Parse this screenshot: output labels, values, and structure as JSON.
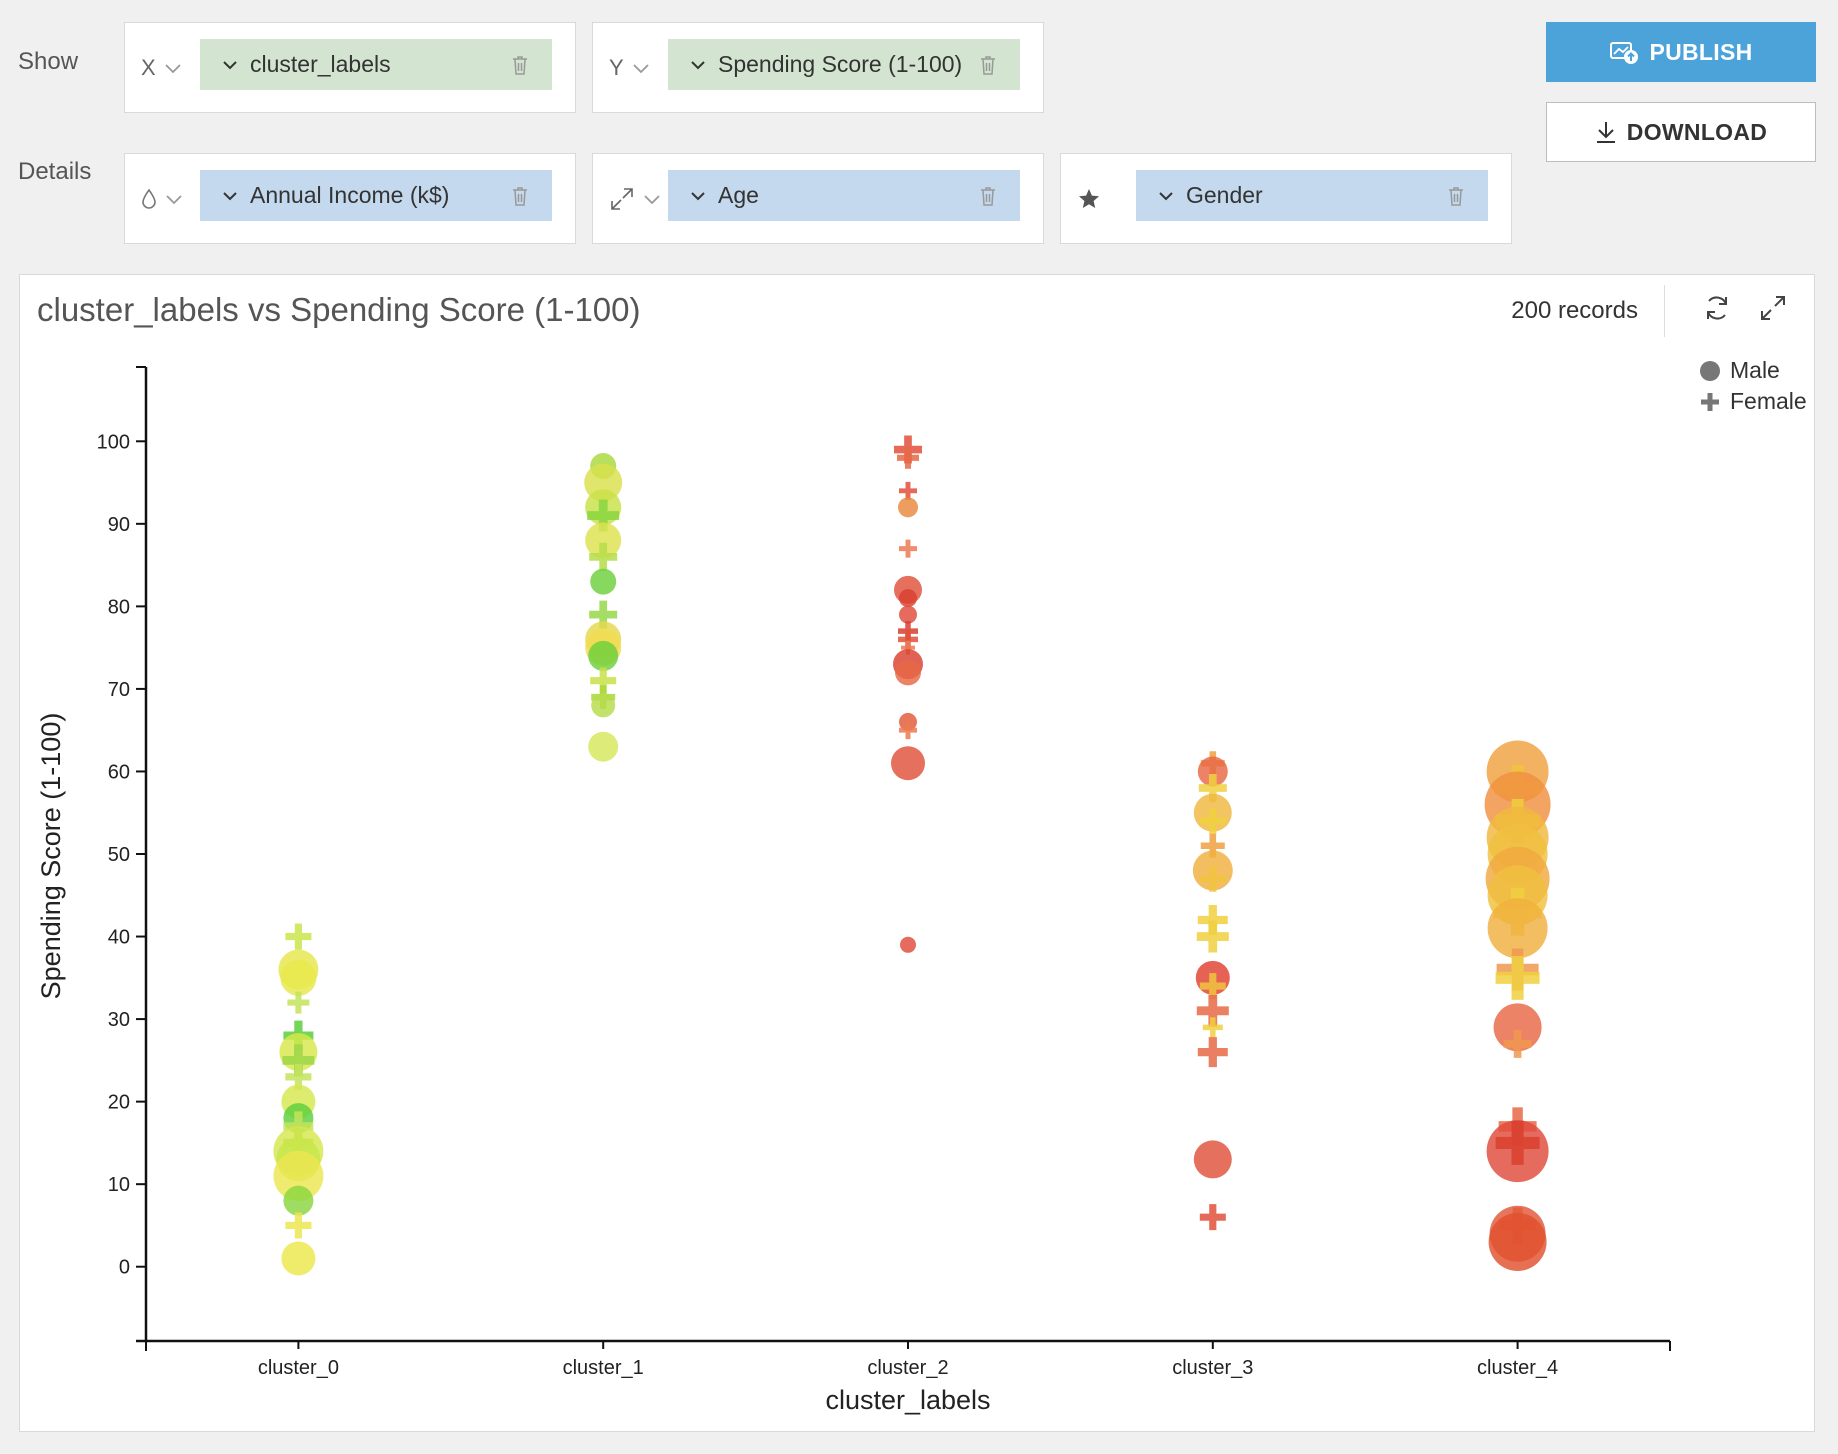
{
  "show_label": "Show",
  "details_label": "Details",
  "x_shelf": {
    "key": "X",
    "field": "cluster_labels"
  },
  "y_shelf": {
    "key": "Y",
    "field": "Spending Score (1-100)"
  },
  "color_shelf": {
    "icon": "droplet-icon",
    "field": "Annual Income (k$)"
  },
  "size_shelf": {
    "icon": "resize-icon",
    "field": "Age"
  },
  "shape_shelf": {
    "icon": "star-icon",
    "field": "Gender"
  },
  "buttons": {
    "publish": "PUBLISH",
    "download": "DOWNLOAD"
  },
  "colors": {
    "accent": "#4ba3da",
    "show_pill": "#d3e5d0",
    "details_pill": "#c4d9ee"
  },
  "panel": {
    "records": "200 records"
  },
  "chart_data": {
    "type": "scatter",
    "title": "cluster_labels vs Spending Score (1-100)",
    "xlabel": "cluster_labels",
    "ylabel": "Spending Score (1-100)",
    "categories": [
      "cluster_0",
      "cluster_1",
      "cluster_2",
      "cluster_3",
      "cluster_4"
    ],
    "ylim": [
      -9,
      109
    ],
    "yticks": [
      0,
      10,
      20,
      30,
      40,
      50,
      60,
      70,
      80,
      90,
      100
    ],
    "grid": false,
    "legend_position": "top-right",
    "legend": [
      {
        "label": "Male",
        "shape": "circle"
      },
      {
        "label": "Female",
        "shape": "plus"
      }
    ],
    "points": [
      {
        "cluster": "cluster_0",
        "y": 40,
        "shape": "plus",
        "size": 13,
        "color": "#c8e64a"
      },
      {
        "cluster": "cluster_0",
        "y": 36,
        "shape": "circle",
        "size": 20,
        "color": "#e6e64a"
      },
      {
        "cluster": "cluster_0",
        "y": 35,
        "shape": "circle",
        "size": 18,
        "color": "#e8e84c"
      },
      {
        "cluster": "cluster_0",
        "y": 32,
        "shape": "plus",
        "size": 11,
        "color": "#c4e35a"
      },
      {
        "cluster": "cluster_0",
        "y": 28,
        "shape": "plus",
        "size": 15,
        "color": "#5ccf3c"
      },
      {
        "cluster": "cluster_0",
        "y": 26,
        "shape": "circle",
        "size": 19,
        "color": "#d8e64a"
      },
      {
        "cluster": "cluster_0",
        "y": 25,
        "shape": "plus",
        "size": 16,
        "color": "#9ed648"
      },
      {
        "cluster": "cluster_0",
        "y": 23,
        "shape": "plus",
        "size": 13,
        "color": "#c4e35a"
      },
      {
        "cluster": "cluster_0",
        "y": 20,
        "shape": "circle",
        "size": 17,
        "color": "#d6e64e"
      },
      {
        "cluster": "cluster_0",
        "y": 18,
        "shape": "circle",
        "size": 15,
        "color": "#5ccf3c"
      },
      {
        "cluster": "cluster_0",
        "y": 17,
        "shape": "plus",
        "size": 15,
        "color": "#c4e35a"
      },
      {
        "cluster": "cluster_0",
        "y": 15,
        "shape": "plus",
        "size": 15,
        "color": "#9ed648"
      },
      {
        "cluster": "cluster_0",
        "y": 14,
        "shape": "circle",
        "size": 25,
        "color": "#d6e64e"
      },
      {
        "cluster": "cluster_0",
        "y": 13,
        "shape": "circle",
        "size": 22,
        "color": "#c8e64a"
      },
      {
        "cluster": "cluster_0",
        "y": 11,
        "shape": "circle",
        "size": 25,
        "color": "#ece650"
      },
      {
        "cluster": "cluster_0",
        "y": 8,
        "shape": "circle",
        "size": 15,
        "color": "#8ad640"
      },
      {
        "cluster": "cluster_0",
        "y": 5,
        "shape": "plus",
        "size": 13,
        "color": "#ece650"
      },
      {
        "cluster": "cluster_0",
        "y": 1,
        "shape": "circle",
        "size": 17,
        "color": "#ece64a"
      },
      {
        "cluster": "cluster_1",
        "y": 97,
        "shape": "circle",
        "size": 13,
        "color": "#a8d83a"
      },
      {
        "cluster": "cluster_1",
        "y": 95,
        "shape": "circle",
        "size": 19,
        "color": "#d9e04c"
      },
      {
        "cluster": "cluster_1",
        "y": 92,
        "shape": "circle",
        "size": 18,
        "color": "#c8e048"
      },
      {
        "cluster": "cluster_1",
        "y": 91,
        "shape": "plus",
        "size": 16,
        "color": "#8ad640"
      },
      {
        "cluster": "cluster_1",
        "y": 88,
        "shape": "circle",
        "size": 18,
        "color": "#dde24e"
      },
      {
        "cluster": "cluster_1",
        "y": 86,
        "shape": "plus",
        "size": 14,
        "color": "#b6dc4a"
      },
      {
        "cluster": "cluster_1",
        "y": 83,
        "shape": "circle",
        "size": 13,
        "color": "#6ccf3c"
      },
      {
        "cluster": "cluster_1",
        "y": 79,
        "shape": "plus",
        "size": 14,
        "color": "#96d84a"
      },
      {
        "cluster": "cluster_1",
        "y": 76,
        "shape": "circle",
        "size": 18,
        "color": "#e6d84c"
      },
      {
        "cluster": "cluster_1",
        "y": 75,
        "shape": "circle",
        "size": 18,
        "color": "#f0dc50"
      },
      {
        "cluster": "cluster_1",
        "y": 74,
        "shape": "circle",
        "size": 15,
        "color": "#6ccf3c"
      },
      {
        "cluster": "cluster_1",
        "y": 71,
        "shape": "plus",
        "size": 13,
        "color": "#c8e048"
      },
      {
        "cluster": "cluster_1",
        "y": 69,
        "shape": "plus",
        "size": 12,
        "color": "#a8d83a"
      },
      {
        "cluster": "cluster_1",
        "y": 68,
        "shape": "circle",
        "size": 12,
        "color": "#b6dc4a"
      },
      {
        "cluster": "cluster_1",
        "y": 63,
        "shape": "circle",
        "size": 15,
        "color": "#d6e65a"
      },
      {
        "cluster": "cluster_2",
        "y": 99,
        "shape": "plus",
        "size": 14,
        "color": "#e0503a"
      },
      {
        "cluster": "cluster_2",
        "y": 98,
        "shape": "plus",
        "size": 11,
        "color": "#e86846"
      },
      {
        "cluster": "cluster_2",
        "y": 94,
        "shape": "plus",
        "size": 9,
        "color": "#e0503a"
      },
      {
        "cluster": "cluster_2",
        "y": 92,
        "shape": "circle",
        "size": 10,
        "color": "#e8883c"
      },
      {
        "cluster": "cluster_2",
        "y": 87,
        "shape": "plus",
        "size": 9,
        "color": "#ec7a52"
      },
      {
        "cluster": "cluster_2",
        "y": 82,
        "shape": "circle",
        "size": 14,
        "color": "#e0503a"
      },
      {
        "cluster": "cluster_2",
        "y": 81,
        "shape": "circle",
        "size": 9,
        "color": "#d8402e"
      },
      {
        "cluster": "cluster_2",
        "y": 79,
        "shape": "circle",
        "size": 9,
        "color": "#e04a3c"
      },
      {
        "cluster": "cluster_2",
        "y": 77,
        "shape": "plus",
        "size": 10,
        "color": "#d8402e"
      },
      {
        "cluster": "cluster_2",
        "y": 76,
        "shape": "plus",
        "size": 10,
        "color": "#e0503a"
      },
      {
        "cluster": "cluster_2",
        "y": 75,
        "shape": "plus",
        "size": 7,
        "color": "#ec7a52"
      },
      {
        "cluster": "cluster_2",
        "y": 73,
        "shape": "circle",
        "size": 15,
        "color": "#d8402e"
      },
      {
        "cluster": "cluster_2",
        "y": 72,
        "shape": "circle",
        "size": 13,
        "color": "#e86846"
      },
      {
        "cluster": "cluster_2",
        "y": 66,
        "shape": "circle",
        "size": 9,
        "color": "#e05838"
      },
      {
        "cluster": "cluster_2",
        "y": 65,
        "shape": "plus",
        "size": 9,
        "color": "#ec7a52"
      },
      {
        "cluster": "cluster_2",
        "y": 61,
        "shape": "circle",
        "size": 17,
        "color": "#e0503a"
      },
      {
        "cluster": "cluster_2",
        "y": 39,
        "shape": "circle",
        "size": 8,
        "color": "#e04a3c"
      },
      {
        "cluster": "cluster_3",
        "y": 61,
        "shape": "plus",
        "size": 12,
        "color": "#f0a040"
      },
      {
        "cluster": "cluster_3",
        "y": 60,
        "shape": "circle",
        "size": 15,
        "color": "#e86846"
      },
      {
        "cluster": "cluster_3",
        "y": 58,
        "shape": "plus",
        "size": 14,
        "color": "#f0d040"
      },
      {
        "cluster": "cluster_3",
        "y": 55,
        "shape": "circle",
        "size": 19,
        "color": "#f0b840"
      },
      {
        "cluster": "cluster_3",
        "y": 54,
        "shape": "plus",
        "size": 13,
        "color": "#f0d040"
      },
      {
        "cluster": "cluster_3",
        "y": 51,
        "shape": "plus",
        "size": 12,
        "color": "#f0a040"
      },
      {
        "cluster": "cluster_3",
        "y": 48,
        "shape": "circle",
        "size": 20,
        "color": "#f0b040"
      },
      {
        "cluster": "cluster_3",
        "y": 47,
        "shape": "plus",
        "size": 13,
        "color": "#f0c440"
      },
      {
        "cluster": "cluster_3",
        "y": 42,
        "shape": "plus",
        "size": 15,
        "color": "#f0d040"
      },
      {
        "cluster": "cluster_3",
        "y": 40,
        "shape": "plus",
        "size": 16,
        "color": "#f0d040"
      },
      {
        "cluster": "cluster_3",
        "y": 35,
        "shape": "circle",
        "size": 17,
        "color": "#e0402e"
      },
      {
        "cluster": "cluster_3",
        "y": 34,
        "shape": "plus",
        "size": 13,
        "color": "#f0c440"
      },
      {
        "cluster": "cluster_3",
        "y": 31,
        "shape": "plus",
        "size": 16,
        "color": "#e86846"
      },
      {
        "cluster": "cluster_3",
        "y": 29,
        "shape": "plus",
        "size": 10,
        "color": "#f0d040"
      },
      {
        "cluster": "cluster_3",
        "y": 26,
        "shape": "plus",
        "size": 15,
        "color": "#e86846"
      },
      {
        "cluster": "cluster_3",
        "y": 13,
        "shape": "circle",
        "size": 19,
        "color": "#e0503a"
      },
      {
        "cluster": "cluster_3",
        "y": 6,
        "shape": "plus",
        "size": 13,
        "color": "#e0503a"
      },
      {
        "cluster": "cluster_4",
        "y": 60,
        "shape": "circle",
        "size": 31,
        "color": "#f0a040"
      },
      {
        "cluster": "cluster_4",
        "y": 58,
        "shape": "plus",
        "size": 23,
        "color": "#f0c440"
      },
      {
        "cluster": "cluster_4",
        "y": 56,
        "shape": "circle",
        "size": 33,
        "color": "#f09040"
      },
      {
        "cluster": "cluster_4",
        "y": 54,
        "shape": "plus",
        "size": 22,
        "color": "#f0d040"
      },
      {
        "cluster": "cluster_4",
        "y": 52,
        "shape": "circle",
        "size": 31,
        "color": "#f0b840"
      },
      {
        "cluster": "cluster_4",
        "y": 50,
        "shape": "circle",
        "size": 30,
        "color": "#f0c040"
      },
      {
        "cluster": "cluster_4",
        "y": 47,
        "shape": "circle",
        "size": 32,
        "color": "#f0a840"
      },
      {
        "cluster": "cluster_4",
        "y": 45,
        "shape": "circle",
        "size": 30,
        "color": "#f0c040"
      },
      {
        "cluster": "cluster_4",
        "y": 43,
        "shape": "plus",
        "size": 24,
        "color": "#f0d040"
      },
      {
        "cluster": "cluster_4",
        "y": 41,
        "shape": "circle",
        "size": 30,
        "color": "#f0b040"
      },
      {
        "cluster": "cluster_4",
        "y": 36,
        "shape": "plus",
        "size": 21,
        "color": "#f09850"
      },
      {
        "cluster": "cluster_4",
        "y": 35,
        "shape": "plus",
        "size": 22,
        "color": "#f0d040"
      },
      {
        "cluster": "cluster_4",
        "y": 29,
        "shape": "circle",
        "size": 24,
        "color": "#e86846"
      },
      {
        "cluster": "cluster_4",
        "y": 27,
        "shape": "plus",
        "size": 14,
        "color": "#f09850"
      },
      {
        "cluster": "cluster_4",
        "y": 17,
        "shape": "plus",
        "size": 19,
        "color": "#e86846"
      },
      {
        "cluster": "cluster_4",
        "y": 14,
        "shape": "circle",
        "size": 31,
        "color": "#e04a3c"
      },
      {
        "cluster": "cluster_4",
        "y": 15,
        "shape": "plus",
        "size": 22,
        "color": "#d8402e"
      },
      {
        "cluster": "cluster_4",
        "y": 5,
        "shape": "plus",
        "size": 18,
        "color": "#e86846"
      },
      {
        "cluster": "cluster_4",
        "y": 4,
        "shape": "circle",
        "size": 28,
        "color": "#e05838"
      },
      {
        "cluster": "cluster_4",
        "y": 3,
        "shape": "circle",
        "size": 29,
        "color": "#e0502e"
      }
    ]
  }
}
